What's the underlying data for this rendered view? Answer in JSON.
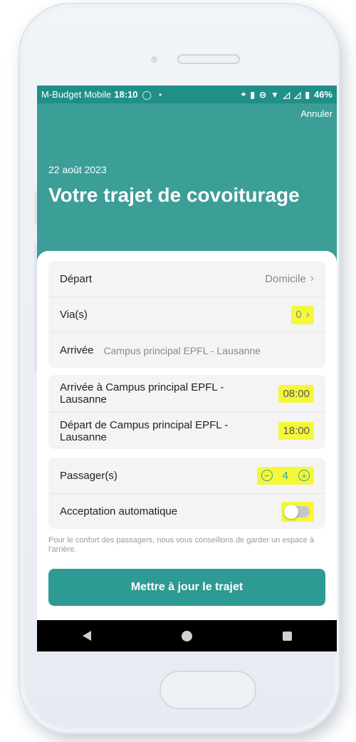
{
  "status_bar": {
    "carrier": "M-Budget Mobile",
    "time": "18:10",
    "battery": "46%",
    "icons": [
      "whatsapp-icon",
      "dot-icon",
      "location-icon",
      "vibrate-icon",
      "dnd-icon",
      "wifi-icon",
      "signal-icon",
      "signal-icon",
      "battery-icon"
    ]
  },
  "header": {
    "cancel_label": "Annuler",
    "date": "22 août 2023",
    "title": "Votre trajet de covoiturage"
  },
  "route": {
    "depart_label": "Départ",
    "depart_value": "Domicile",
    "via_label": "Via(s)",
    "via_value": "0",
    "arrival_label": "Arrivée",
    "arrival_value": "Campus principal EPFL - Lausanne"
  },
  "times": {
    "arrival_label": "Arrivée à Campus principal EPFL - Lausanne",
    "arrival_time": "08:00",
    "departure_label": "Départ de Campus principal EPFL - Lausanne",
    "departure_time": "18:00"
  },
  "passengers": {
    "label": "Passager(s)",
    "count": "4",
    "auto_accept_label": "Acceptation automatique",
    "auto_accept_on": false
  },
  "note": "Pour le confort des passagers, nous vous conseillons de garder un espace à l'arrière.",
  "cta_label": "Mettre à jour le trajet",
  "colors": {
    "teal": "#3b9e97",
    "teal_dark": "#1f8f87",
    "highlight": "#f4f83a"
  }
}
